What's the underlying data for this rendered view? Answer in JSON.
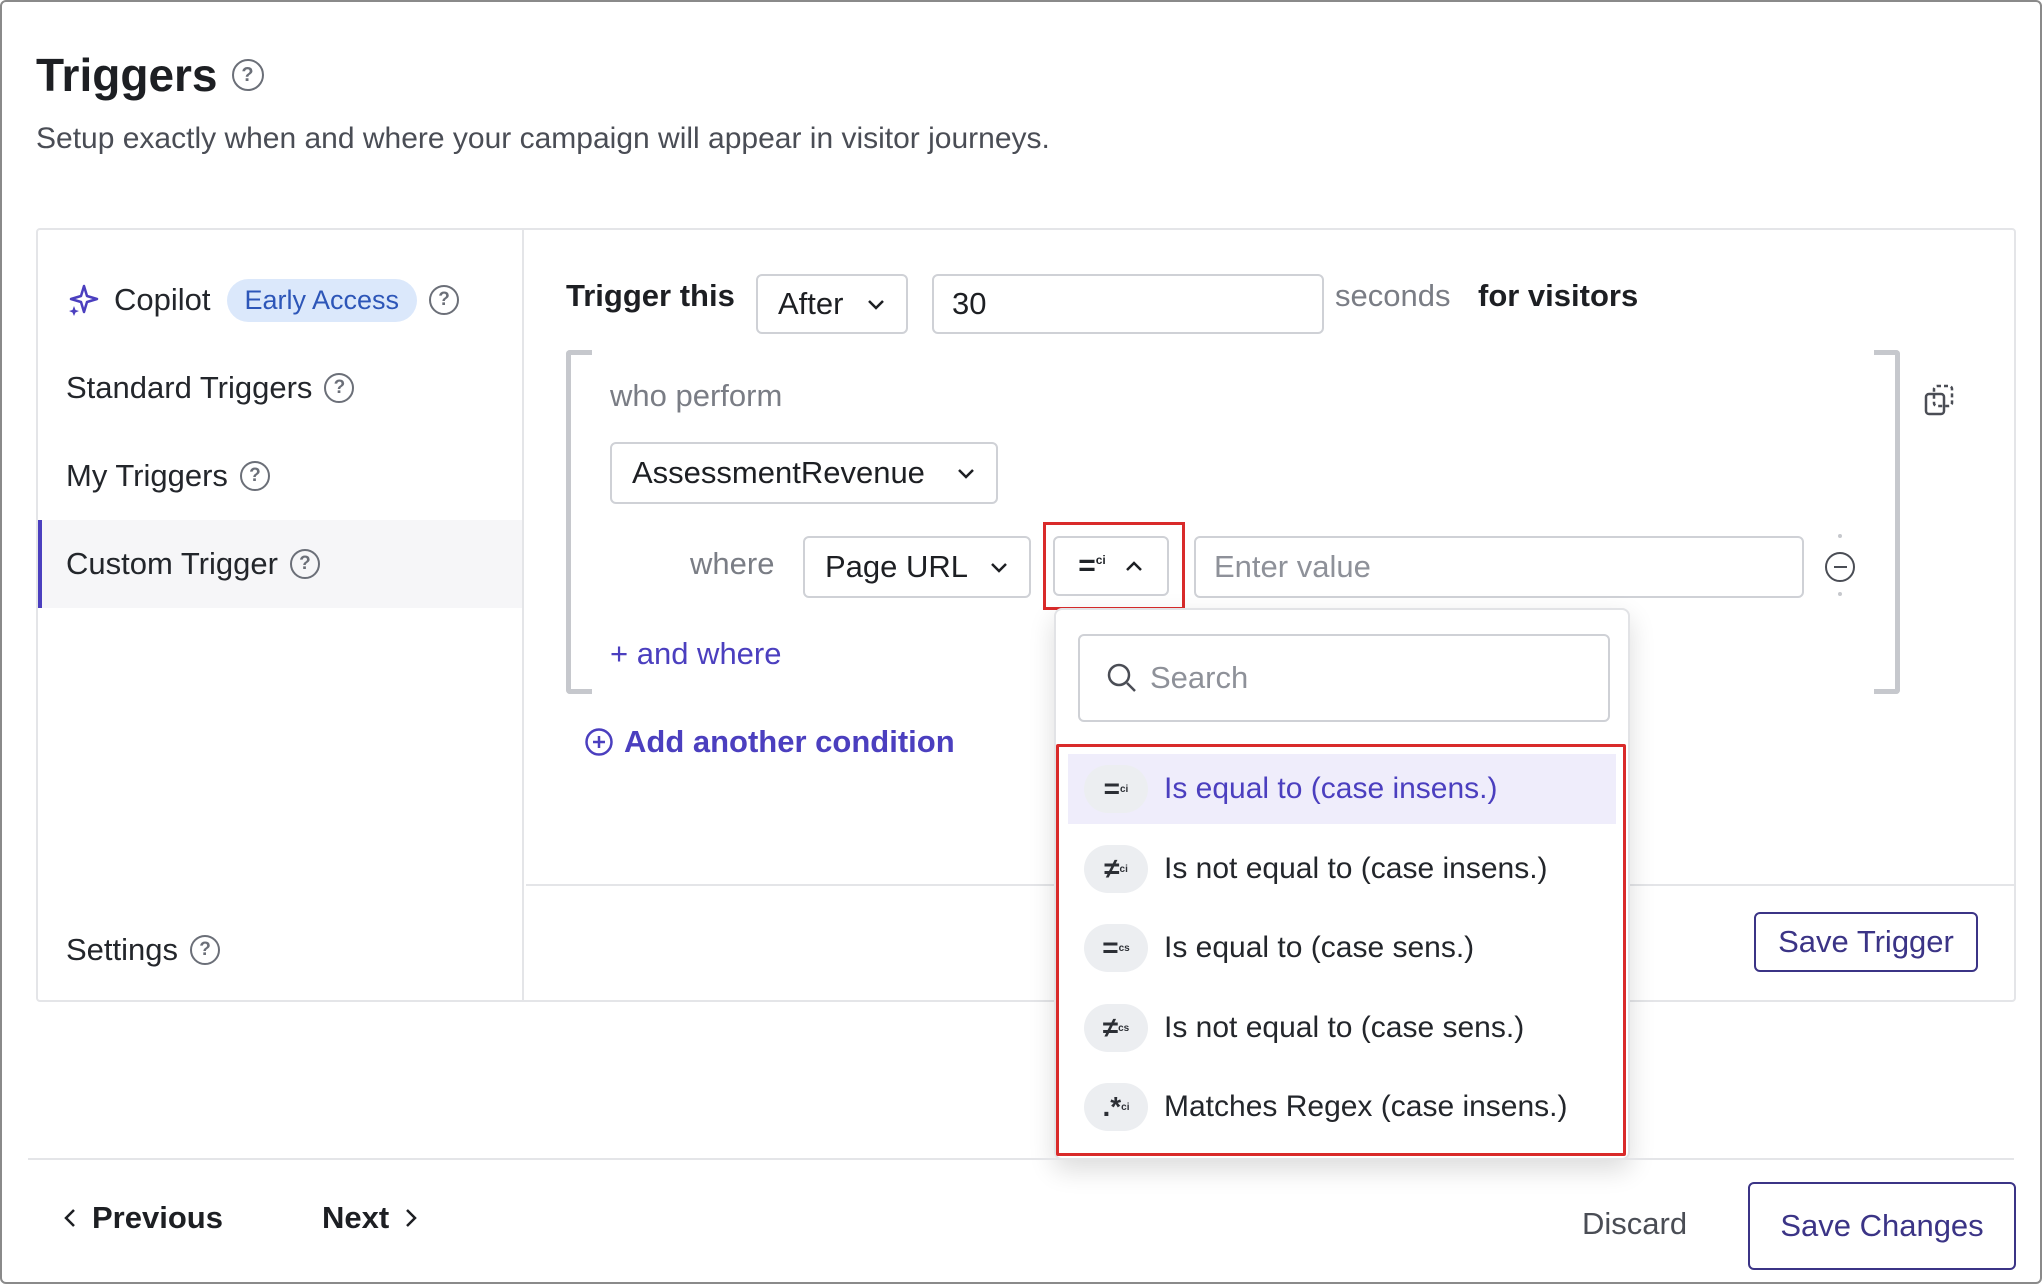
{
  "header": {
    "title": "Triggers",
    "subtitle": "Setup exactly when and where your campaign will appear in visitor journeys."
  },
  "sidebar": {
    "items": [
      {
        "label": "Copilot",
        "badge": "Early Access"
      },
      {
        "label": "Standard Triggers"
      },
      {
        "label": "My Triggers"
      },
      {
        "label": "Custom Trigger"
      }
    ],
    "settings_label": "Settings"
  },
  "trigger": {
    "prefix": "Trigger this",
    "timing_select": "After",
    "seconds_value": "30",
    "seconds_label": "seconds",
    "suffix": "for visitors",
    "who_perform_label": "who perform",
    "event_select": "AssessmentRevenue",
    "where_label": "where",
    "property_select": "Page URL",
    "operator_symbol": "=",
    "operator_sup": "ci",
    "value_placeholder": "Enter value",
    "and_where_label": "+ and where",
    "add_condition_label": "Add another condition",
    "save_trigger_label": "Save Trigger"
  },
  "operator_dropdown": {
    "search_placeholder": "Search",
    "options": [
      {
        "symbol": "=",
        "sup": "ci",
        "label": "Is equal to (case insens.)",
        "selected": true
      },
      {
        "symbol": "≠",
        "sup": "ci",
        "label": "Is not equal to (case insens.)",
        "selected": false
      },
      {
        "symbol": "=",
        "sup": "cs",
        "label": "Is equal to (case sens.)",
        "selected": false
      },
      {
        "symbol": "≠",
        "sup": "cs",
        "label": "Is not equal to (case sens.)",
        "selected": false
      },
      {
        "symbol": ".*",
        "sup": "ci",
        "label": "Matches Regex (case insens.)",
        "selected": false
      }
    ]
  },
  "footer": {
    "previous_label": "Previous",
    "next_label": "Next",
    "discard_label": "Discard",
    "save_changes_label": "Save Changes"
  },
  "colors": {
    "accent": "#4b3fbf",
    "highlight": "#d92a2a",
    "badge_bg": "#dbe8fb"
  }
}
